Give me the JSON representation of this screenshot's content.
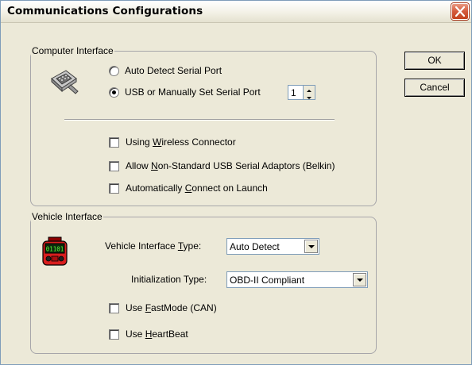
{
  "window": {
    "title": "Communications Configurations"
  },
  "computer_interface": {
    "legend": "Computer Interface",
    "auto_detect_label": "Auto Detect Serial Port",
    "usb_label": "USB or Manually Set Serial Port",
    "port_value": "1",
    "selected_option": "usb",
    "wireless": {
      "before": "Using ",
      "mnemonic": "W",
      "after": "ireless Connector",
      "checked": false
    },
    "nonstandard": {
      "before": "Allow ",
      "mnemonic": "N",
      "after": "on-Standard USB Serial Adaptors (Belkin)",
      "checked": false
    },
    "autoconnect": {
      "before": "Automatically ",
      "mnemonic": "C",
      "after": "onnect on Launch",
      "checked": false
    }
  },
  "vehicle_interface": {
    "legend": "Vehicle Interface",
    "type_label": {
      "before": "Vehicle Interface ",
      "mnemonic": "T",
      "after": "ype:"
    },
    "type_value": "Auto Detect",
    "init_label": "Initialization Type:",
    "init_value": "OBD-II Compliant",
    "fastmode": {
      "before": "Use ",
      "mnemonic": "F",
      "after": "astMode (CAN)",
      "checked": false
    },
    "heartbeat": {
      "before": "Use ",
      "mnemonic": "H",
      "after": "eartBeat",
      "checked": false
    },
    "device_icon_text": "01101"
  },
  "buttons": {
    "ok": "OK",
    "cancel": "Cancel"
  },
  "icons": {
    "serial": "serial-connector-icon",
    "device": "obd-device-icon",
    "close": "close-icon"
  }
}
